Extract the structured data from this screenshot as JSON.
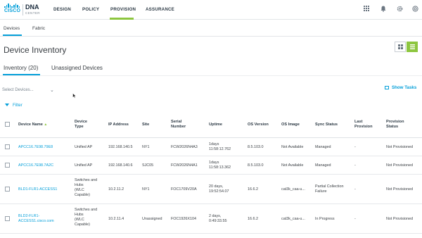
{
  "brand": {
    "company": "CISCO",
    "product": "DNA",
    "product_sub": "CENTER"
  },
  "nav": {
    "items": [
      {
        "label": "DESIGN"
      },
      {
        "label": "POLICY"
      },
      {
        "label": "PROVISION",
        "active": true
      },
      {
        "label": "ASSURANCE"
      }
    ],
    "icons": [
      "apps-grid-icon",
      "bell-icon",
      "gear-icon",
      "help-icon"
    ]
  },
  "subtabs": [
    {
      "label": "Devices",
      "active": true
    },
    {
      "label": "Fabric"
    }
  ],
  "page": {
    "title": "Device Inventory"
  },
  "inventory_tabs": [
    {
      "label": "Inventory (20)",
      "active": true
    },
    {
      "label": "Unassigned Devices"
    }
  ],
  "controls": {
    "select_placeholder": "Select Devices...",
    "show_tasks": "Show Tasks",
    "filter": "Filter"
  },
  "table": {
    "columns": [
      [
        "Device Name"
      ],
      [
        "Device",
        "Type"
      ],
      [
        "IP Address"
      ],
      [
        "Site"
      ],
      [
        "Serial",
        "Number"
      ],
      [
        "Uptime"
      ],
      [
        "OS Version"
      ],
      [
        "OS Image"
      ],
      [
        "Sync Status"
      ],
      [
        "Last",
        "Provision"
      ],
      [
        "Provision",
        "Status"
      ]
    ],
    "rows": [
      {
        "name": [
          "APCC16.7E98.79E8"
        ],
        "type": [
          "Unified AP"
        ],
        "ip": "192.168.140.5",
        "site": "NY1",
        "serial": "FCW2026N4A3",
        "uptime": [
          "1days",
          "11:58:12.762"
        ],
        "os_version": "8.5.103.0",
        "os_image": "Not Available",
        "sync": [
          "Managed"
        ],
        "last_provision": "-",
        "provision_status": "Not Provisioned"
      },
      {
        "name": [
          "APCC16.7E98.7A2C"
        ],
        "type": [
          "Unified AP"
        ],
        "ip": "192.168.140.6",
        "site": "SJC05",
        "serial": "FCW2026N4A1",
        "uptime": [
          "1days",
          "11:58:13.362"
        ],
        "os_version": "8.5.103.0",
        "os_image": "Not Available",
        "sync": [
          "Managed"
        ],
        "last_provision": "-",
        "provision_status": "Not Provisioned"
      },
      {
        "name": [
          "BLD1-FLR1-ACCESS1"
        ],
        "type": [
          "Switches and",
          "Hubs",
          "(WLC",
          "Capable)"
        ],
        "ip": "10.2.11.2",
        "site": "NY1",
        "serial": "FOC1709V20A",
        "uptime": [
          "20 days,",
          "19:52:54.07"
        ],
        "os_version": "16.6.2",
        "os_image": "cat3k_caa-u...",
        "sync": [
          "Partial Collection",
          "Failure"
        ],
        "last_provision": "-",
        "provision_status": "Not Provisioned"
      },
      {
        "name": [
          "BLD2-FLR1-",
          "ACCESS1.cisco.com"
        ],
        "type": [
          "Switches and",
          "Hubs",
          "(WLC",
          "Capable)"
        ],
        "ip": "10.2.11.4",
        "site": "Unassigned",
        "serial": "FOC1926X104",
        "uptime": [
          "2 days,",
          "0:49:33.55"
        ],
        "os_version": "16.6.2",
        "os_image": "cat3k_caa-u...",
        "sync": [
          "In Progress"
        ],
        "last_provision": "-",
        "provision_status": "Not Provisioned"
      }
    ]
  },
  "colors": {
    "accent_green": "#8dc63f",
    "link_blue": "#049fd9",
    "text": "#3a3f44"
  }
}
